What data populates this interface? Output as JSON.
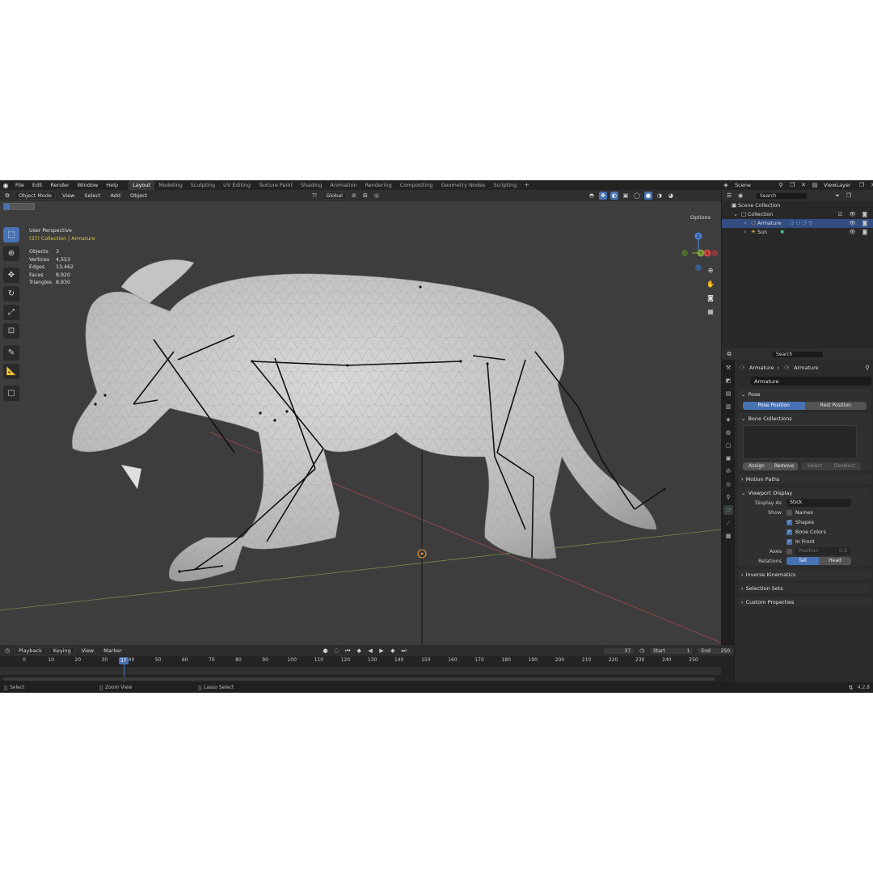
{
  "topbar": {
    "menus": [
      "File",
      "Edit",
      "Render",
      "Window",
      "Help"
    ],
    "workspaces": [
      "Layout",
      "Modeling",
      "Sculpting",
      "UV Editing",
      "Texture Paint",
      "Shading",
      "Animation",
      "Rendering",
      "Compositing",
      "Geometry Nodes",
      "Scripting"
    ],
    "active_workspace": "Layout",
    "scene": "Scene",
    "view_layer": "ViewLayer",
    "add_tab": "+"
  },
  "viewport": {
    "mode": "Object Mode",
    "menus": [
      "View",
      "Select",
      "Add",
      "Object"
    ],
    "orientation": "Global",
    "options": "Options",
    "view_name": "User Perspective",
    "collection_info": "(37) Collection | Armature",
    "stats": [
      {
        "label": "Objects",
        "value": "3"
      },
      {
        "label": "Vertices",
        "value": "4,553"
      },
      {
        "label": "Edges",
        "value": "13,462"
      },
      {
        "label": "Faces",
        "value": "8,920"
      },
      {
        "label": "Triangles",
        "value": "8,930"
      }
    ],
    "gizmo": {
      "z": "Z",
      "x": "X",
      "y": "Y"
    }
  },
  "outliner": {
    "search_placeholder": "Search",
    "items": [
      {
        "label": "Scene Collection",
        "level": 0
      },
      {
        "label": "Collection",
        "level": 1
      },
      {
        "label": "Armature",
        "level": 2,
        "selected": true
      },
      {
        "label": "Sun",
        "level": 2
      }
    ]
  },
  "properties": {
    "search_placeholder": "Search",
    "breadcrumb": [
      "Armature",
      "Armature"
    ],
    "data_name": "Armature",
    "pose_panel": {
      "title": "Pose",
      "buttons": [
        "Pose Position",
        "Rest Position"
      ],
      "active": "Pose Position"
    },
    "bone_collections": {
      "title": "Bone Collections",
      "buttons": [
        "Assign",
        "Remove",
        "Select",
        "Deselect"
      ]
    },
    "motion_paths": "Motion Paths",
    "viewport_display": {
      "title": "Viewport Display",
      "display_as_label": "Display As",
      "display_as_value": "Stick",
      "show_label": "Show",
      "show_options": [
        {
          "label": "Names",
          "checked": false
        },
        {
          "label": "Shapes",
          "checked": true
        },
        {
          "label": "Bone Colors",
          "checked": true
        },
        {
          "label": "In Front",
          "checked": true
        }
      ],
      "axes_label": "Axes",
      "axes_position_label": "Position",
      "axes_position_value": "0.0",
      "relations_label": "Relations",
      "relations_options": [
        "Tail",
        "Head"
      ],
      "relations_active": "Tail"
    },
    "collapsed_panels": [
      "Inverse Kinematics",
      "Selection Sets",
      "Custom Properties"
    ]
  },
  "timeline": {
    "menus": [
      "Playback",
      "Keying",
      "View",
      "Marker"
    ],
    "current_frame": "37",
    "start_label": "Start",
    "start": "1",
    "end_label": "End",
    "end": "250",
    "ticks": [
      "0",
      "10",
      "20",
      "30",
      "40",
      "50",
      "60",
      "70",
      "80",
      "90",
      "100",
      "110",
      "120",
      "130",
      "140",
      "150",
      "160",
      "170",
      "180",
      "190",
      "200",
      "210",
      "220",
      "230",
      "240",
      "250"
    ]
  },
  "statusbar": {
    "items": [
      "Select",
      "Zoom View",
      "Lasso Select"
    ],
    "version": "4.2.8"
  },
  "colors": {
    "accent": "#4772b3",
    "selected_row": "#334d80",
    "collection_text": "#e6c344"
  }
}
